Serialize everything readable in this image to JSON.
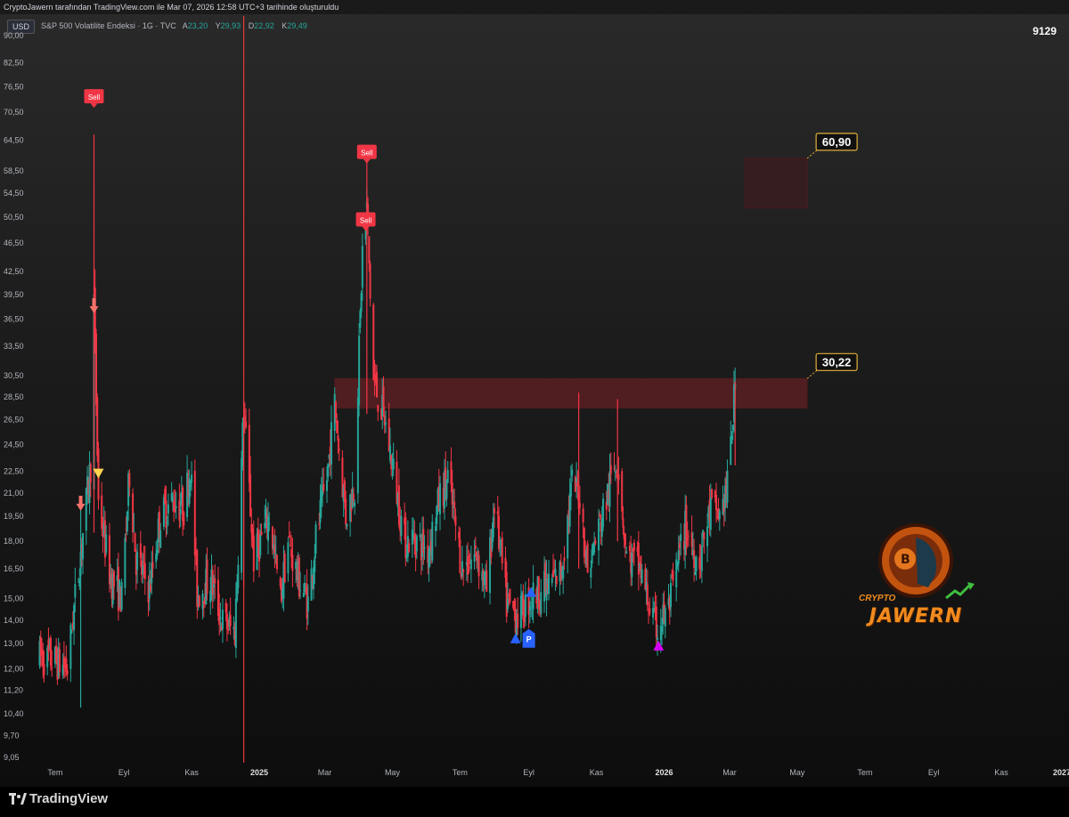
{
  "header": {
    "attribution": "CryptoJawern tarafından TradingView.com ile Mar 07, 2026 12:58 UTC+3 tarihinde oluşturuldu",
    "currency": "USD",
    "symbol_badge": "9129"
  },
  "legend": {
    "name": "S&P 500 Volatilite Endeksi · 1G · TVC",
    "open_label": "A",
    "open": "23,20",
    "high_label": "Y",
    "high": "29,93",
    "low_label": "D",
    "low": "22,92",
    "close_label": "K",
    "close": "29,49"
  },
  "footer": {
    "brand": "TradingView"
  },
  "watermark": {
    "word": "JAWERN",
    "small": "CRYPTO"
  },
  "chart_data": {
    "type": "candlestick",
    "title": "S&P 500 Volatilite Endeksi · 1G · TVC",
    "y_scale": "log",
    "ylim": [
      9.05,
      90.0
    ],
    "y_ticks": [
      "90,00",
      "82,50",
      "76,50",
      "70,50",
      "64,50",
      "58,50",
      "54,50",
      "50,50",
      "46,50",
      "42,50",
      "39,50",
      "36,50",
      "33,50",
      "30,50",
      "28,50",
      "26,50",
      "24,50",
      "22,50",
      "21,00",
      "19,50",
      "18,00",
      "16,50",
      "15,00",
      "14,00",
      "13,00",
      "12,00",
      "11,20",
      "10,40",
      "9,70",
      "9,05"
    ],
    "x_ticks": [
      "Tem",
      "Eyl",
      "Kas",
      "2025",
      "Mar",
      "May",
      "Tem",
      "Eyl",
      "Kas",
      "2026",
      "Mar",
      "May",
      "Tem",
      "Eyl",
      "Kas",
      "2027"
    ],
    "x_range": [
      "2024-06-15",
      "2027-01-01"
    ],
    "anchors": [
      [
        "2024-06-15",
        12.5
      ],
      [
        "2024-07-01",
        12.3
      ],
      [
        "2024-07-12",
        12.0
      ],
      [
        "2024-07-20",
        15.5
      ],
      [
        "2024-07-26",
        18.5
      ],
      [
        "2024-08-02",
        23.0
      ],
      [
        "2024-08-05",
        38.6
      ],
      [
        "2024-08-09",
        20.4
      ],
      [
        "2024-08-20",
        16.0
      ],
      [
        "2024-08-30",
        15.0
      ],
      [
        "2024-09-06",
        22.4
      ],
      [
        "2024-09-12",
        17.0
      ],
      [
        "2024-09-24",
        15.5
      ],
      [
        "2024-10-04",
        19.5
      ],
      [
        "2024-10-15",
        20.5
      ],
      [
        "2024-10-25",
        20.0
      ],
      [
        "2024-10-31",
        23.0
      ],
      [
        "2024-11-06",
        15.2
      ],
      [
        "2024-11-18",
        16.0
      ],
      [
        "2024-11-28",
        14.0
      ],
      [
        "2024-12-10",
        13.5
      ],
      [
        "2024-12-18",
        27.6
      ],
      [
        "2024-12-27",
        17.0
      ],
      [
        "2025-01-10",
        19.5
      ],
      [
        "2025-01-20",
        15.0
      ],
      [
        "2025-01-27",
        18.0
      ],
      [
        "2025-02-05",
        16.0
      ],
      [
        "2025-02-14",
        14.8
      ],
      [
        "2025-02-21",
        18.2
      ],
      [
        "2025-03-03",
        22.0
      ],
      [
        "2025-03-10",
        27.9
      ],
      [
        "2025-03-20",
        19.5
      ],
      [
        "2025-03-28",
        21.6
      ],
      [
        "2025-04-04",
        45.3
      ],
      [
        "2025-04-08",
        52.0
      ],
      [
        "2025-04-14",
        30.0
      ],
      [
        "2025-04-24",
        26.5
      ],
      [
        "2025-05-02",
        22.5
      ],
      [
        "2025-05-12",
        18.0
      ],
      [
        "2025-05-20",
        18.2
      ],
      [
        "2025-06-02",
        17.5
      ],
      [
        "2025-06-13",
        20.8
      ],
      [
        "2025-06-20",
        22.0
      ],
      [
        "2025-07-03",
        16.5
      ],
      [
        "2025-07-16",
        17.3
      ],
      [
        "2025-07-25",
        15.4
      ],
      [
        "2025-08-01",
        20.4
      ],
      [
        "2025-08-12",
        14.7
      ],
      [
        "2025-08-22",
        14.2
      ],
      [
        "2025-09-05",
        15.2
      ],
      [
        "2025-09-18",
        15.6
      ],
      [
        "2025-09-30",
        16.3
      ],
      [
        "2025-10-10",
        21.6
      ],
      [
        "2025-10-17",
        20.8
      ],
      [
        "2025-10-24",
        16.4
      ],
      [
        "2025-11-04",
        19.0
      ],
      [
        "2025-11-20",
        23.7
      ],
      [
        "2025-11-28",
        17.2
      ],
      [
        "2025-12-10",
        16.5
      ],
      [
        "2025-12-24",
        13.6
      ],
      [
        "2026-01-05",
        14.5
      ],
      [
        "2026-01-20",
        18.8
      ],
      [
        "2026-02-01",
        16.8
      ],
      [
        "2026-02-12",
        20.0
      ],
      [
        "2026-02-20",
        19.5
      ],
      [
        "2026-02-27",
        21.4
      ],
      [
        "2026-03-06",
        29.49
      ]
    ],
    "annotations": [
      {
        "type": "level_box",
        "label": "30,22",
        "from": "2025-03-10",
        "to": "2026-05-10",
        "low": 27.5,
        "high": 30.22,
        "color": "#5a1f22"
      },
      {
        "type": "level_box",
        "label": "60,90",
        "from": "2026-03-15",
        "to": "2026-05-10",
        "low": 52.0,
        "high": 60.9,
        "color": "#3a1c1e"
      },
      {
        "type": "vline",
        "date": "2024-12-18",
        "color": "#e53935"
      }
    ],
    "signals": [
      {
        "label": "Sell",
        "date": "2024-08-05",
        "value": 74.0,
        "color": "#f23645"
      },
      {
        "label": "Sell",
        "date": "2025-04-08",
        "value": 62.0,
        "color": "#f23645"
      },
      {
        "label": "Sell",
        "date": "2025-04-07",
        "value": 50.0,
        "color": "#f23645"
      },
      {
        "label": "",
        "kind": "arrow-down",
        "date": "2024-08-05",
        "value": 37.5,
        "color": "#f4726a"
      },
      {
        "label": "",
        "kind": "arrow-down",
        "date": "2024-07-24",
        "value": 20.0,
        "color": "#f4726a"
      },
      {
        "label": "",
        "kind": "triangle-down",
        "date": "2024-08-09",
        "value": 22.3,
        "color": "#ffd54f"
      },
      {
        "label": "",
        "kind": "triangle-up",
        "date": "2025-08-20",
        "value": 13.2,
        "color": "#2962ff"
      },
      {
        "label": "P",
        "kind": "badge",
        "date": "2025-09-01",
        "value": 13.2,
        "color": "#2962ff"
      },
      {
        "label": "",
        "kind": "triangle-up",
        "date": "2025-09-03",
        "value": 15.3,
        "color": "#2962ff"
      },
      {
        "label": "",
        "kind": "triangle-up",
        "date": "2025-12-27",
        "value": 12.9,
        "color": "#d500f9"
      }
    ]
  }
}
